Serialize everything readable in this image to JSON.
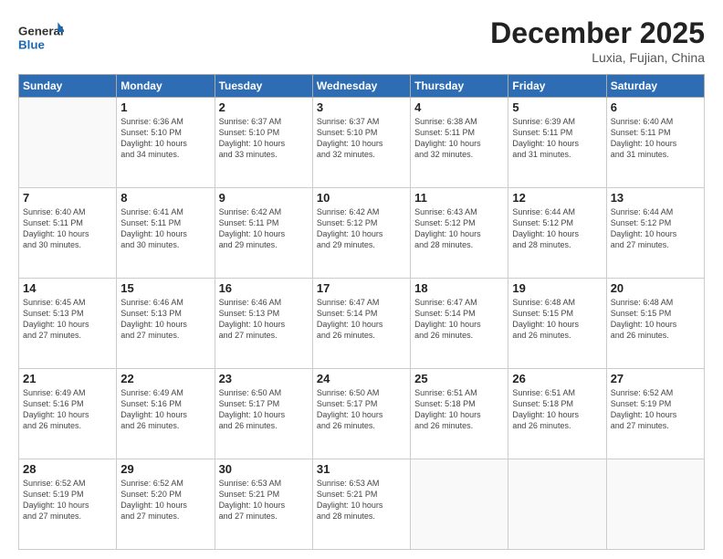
{
  "header": {
    "logo_general": "General",
    "logo_blue": "Blue",
    "month_title": "December 2025",
    "subtitle": "Luxia, Fujian, China"
  },
  "weekdays": [
    "Sunday",
    "Monday",
    "Tuesday",
    "Wednesday",
    "Thursday",
    "Friday",
    "Saturday"
  ],
  "weeks": [
    [
      {
        "day": "",
        "info": ""
      },
      {
        "day": "1",
        "info": "Sunrise: 6:36 AM\nSunset: 5:10 PM\nDaylight: 10 hours\nand 34 minutes."
      },
      {
        "day": "2",
        "info": "Sunrise: 6:37 AM\nSunset: 5:10 PM\nDaylight: 10 hours\nand 33 minutes."
      },
      {
        "day": "3",
        "info": "Sunrise: 6:37 AM\nSunset: 5:10 PM\nDaylight: 10 hours\nand 32 minutes."
      },
      {
        "day": "4",
        "info": "Sunrise: 6:38 AM\nSunset: 5:11 PM\nDaylight: 10 hours\nand 32 minutes."
      },
      {
        "day": "5",
        "info": "Sunrise: 6:39 AM\nSunset: 5:11 PM\nDaylight: 10 hours\nand 31 minutes."
      },
      {
        "day": "6",
        "info": "Sunrise: 6:40 AM\nSunset: 5:11 PM\nDaylight: 10 hours\nand 31 minutes."
      }
    ],
    [
      {
        "day": "7",
        "info": "Sunrise: 6:40 AM\nSunset: 5:11 PM\nDaylight: 10 hours\nand 30 minutes."
      },
      {
        "day": "8",
        "info": "Sunrise: 6:41 AM\nSunset: 5:11 PM\nDaylight: 10 hours\nand 30 minutes."
      },
      {
        "day": "9",
        "info": "Sunrise: 6:42 AM\nSunset: 5:11 PM\nDaylight: 10 hours\nand 29 minutes."
      },
      {
        "day": "10",
        "info": "Sunrise: 6:42 AM\nSunset: 5:12 PM\nDaylight: 10 hours\nand 29 minutes."
      },
      {
        "day": "11",
        "info": "Sunrise: 6:43 AM\nSunset: 5:12 PM\nDaylight: 10 hours\nand 28 minutes."
      },
      {
        "day": "12",
        "info": "Sunrise: 6:44 AM\nSunset: 5:12 PM\nDaylight: 10 hours\nand 28 minutes."
      },
      {
        "day": "13",
        "info": "Sunrise: 6:44 AM\nSunset: 5:12 PM\nDaylight: 10 hours\nand 27 minutes."
      }
    ],
    [
      {
        "day": "14",
        "info": "Sunrise: 6:45 AM\nSunset: 5:13 PM\nDaylight: 10 hours\nand 27 minutes."
      },
      {
        "day": "15",
        "info": "Sunrise: 6:46 AM\nSunset: 5:13 PM\nDaylight: 10 hours\nand 27 minutes."
      },
      {
        "day": "16",
        "info": "Sunrise: 6:46 AM\nSunset: 5:13 PM\nDaylight: 10 hours\nand 27 minutes."
      },
      {
        "day": "17",
        "info": "Sunrise: 6:47 AM\nSunset: 5:14 PM\nDaylight: 10 hours\nand 26 minutes."
      },
      {
        "day": "18",
        "info": "Sunrise: 6:47 AM\nSunset: 5:14 PM\nDaylight: 10 hours\nand 26 minutes."
      },
      {
        "day": "19",
        "info": "Sunrise: 6:48 AM\nSunset: 5:15 PM\nDaylight: 10 hours\nand 26 minutes."
      },
      {
        "day": "20",
        "info": "Sunrise: 6:48 AM\nSunset: 5:15 PM\nDaylight: 10 hours\nand 26 minutes."
      }
    ],
    [
      {
        "day": "21",
        "info": "Sunrise: 6:49 AM\nSunset: 5:16 PM\nDaylight: 10 hours\nand 26 minutes."
      },
      {
        "day": "22",
        "info": "Sunrise: 6:49 AM\nSunset: 5:16 PM\nDaylight: 10 hours\nand 26 minutes."
      },
      {
        "day": "23",
        "info": "Sunrise: 6:50 AM\nSunset: 5:17 PM\nDaylight: 10 hours\nand 26 minutes."
      },
      {
        "day": "24",
        "info": "Sunrise: 6:50 AM\nSunset: 5:17 PM\nDaylight: 10 hours\nand 26 minutes."
      },
      {
        "day": "25",
        "info": "Sunrise: 6:51 AM\nSunset: 5:18 PM\nDaylight: 10 hours\nand 26 minutes."
      },
      {
        "day": "26",
        "info": "Sunrise: 6:51 AM\nSunset: 5:18 PM\nDaylight: 10 hours\nand 26 minutes."
      },
      {
        "day": "27",
        "info": "Sunrise: 6:52 AM\nSunset: 5:19 PM\nDaylight: 10 hours\nand 27 minutes."
      }
    ],
    [
      {
        "day": "28",
        "info": "Sunrise: 6:52 AM\nSunset: 5:19 PM\nDaylight: 10 hours\nand 27 minutes."
      },
      {
        "day": "29",
        "info": "Sunrise: 6:52 AM\nSunset: 5:20 PM\nDaylight: 10 hours\nand 27 minutes."
      },
      {
        "day": "30",
        "info": "Sunrise: 6:53 AM\nSunset: 5:21 PM\nDaylight: 10 hours\nand 27 minutes."
      },
      {
        "day": "31",
        "info": "Sunrise: 6:53 AM\nSunset: 5:21 PM\nDaylight: 10 hours\nand 28 minutes."
      },
      {
        "day": "",
        "info": ""
      },
      {
        "day": "",
        "info": ""
      },
      {
        "day": "",
        "info": ""
      }
    ]
  ]
}
